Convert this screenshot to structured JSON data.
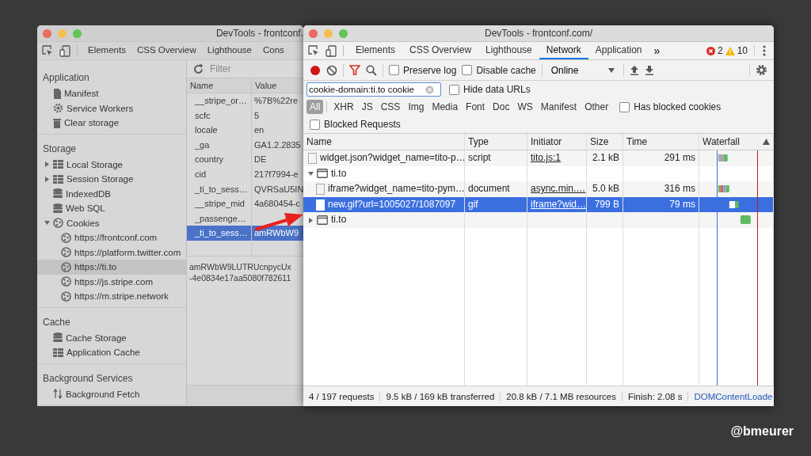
{
  "back_window": {
    "title": "DevTools - frontconf.",
    "tabs": [
      {
        "label": "Elements",
        "selected": false
      },
      {
        "label": "CSS Overview",
        "selected": false
      },
      {
        "label": "Lighthouse",
        "selected": false
      },
      {
        "label": "Cons",
        "selected": false
      }
    ],
    "sidebar": [
      {
        "title": "Application",
        "items": [
          {
            "label": "Manifest",
            "kind": "file",
            "selected": false
          },
          {
            "label": "Service Workers",
            "kind": "gear",
            "selected": false
          },
          {
            "label": "Clear storage",
            "kind": "trash",
            "selected": false
          }
        ]
      },
      {
        "title": "Storage",
        "items": [
          {
            "label": "Local Storage",
            "kind": "grid",
            "expanded": false,
            "selected": false
          },
          {
            "label": "Session Storage",
            "kind": "grid",
            "expanded": false,
            "selected": false
          },
          {
            "label": "IndexedDB",
            "kind": "db",
            "selected": false
          },
          {
            "label": "Web SQL",
            "kind": "db",
            "selected": false
          },
          {
            "label": "Cookies",
            "kind": "cookie",
            "expanded": true,
            "selected": false,
            "children": [
              {
                "label": "https://frontconf.com",
                "kind": "cookie",
                "selected": false
              },
              {
                "label": "https://platform.twitter.com",
                "kind": "cookie",
                "selected": false
              },
              {
                "label": "https://ti.to",
                "kind": "cookie",
                "selected": true
              },
              {
                "label": "https://js.stripe.com",
                "kind": "cookie",
                "selected": false
              },
              {
                "label": "https://m.stripe.network",
                "kind": "cookie",
                "selected": false
              }
            ]
          }
        ]
      },
      {
        "title": "Cache",
        "items": [
          {
            "label": "Cache Storage",
            "kind": "db",
            "selected": false
          },
          {
            "label": "Application Cache",
            "kind": "grid",
            "selected": false
          }
        ]
      },
      {
        "title": "Background Services",
        "items": [
          {
            "label": "Background Fetch",
            "kind": "updown",
            "selected": false
          }
        ]
      }
    ],
    "filter": {
      "placeholder": "Filter"
    },
    "cookies_table": {
      "columns": [
        "Name",
        "Value"
      ],
      "rows": [
        {
          "name": "__stripe_or…",
          "value": "%7B%22re",
          "selected": false
        },
        {
          "name": "scfc",
          "value": "5",
          "selected": false
        },
        {
          "name": "locale",
          "value": "en",
          "selected": false
        },
        {
          "name": "_ga",
          "value": "GA1.2.2835",
          "selected": false
        },
        {
          "name": "country",
          "value": "DE",
          "selected": false
        },
        {
          "name": "cid",
          "value": "217f7994-e",
          "selected": false
        },
        {
          "name": "_ti_to_sess…",
          "value": "QVRSaU5IN",
          "selected": false
        },
        {
          "name": "__stripe_mid",
          "value": "4a680454-c",
          "selected": false
        },
        {
          "name": "_passenge…",
          "selected": false
        },
        {
          "name": "_ti_to_sess…",
          "value": "amRWbW9",
          "selected": true
        }
      ]
    },
    "value_preview": [
      "amRWbW9LUTRUcnpycUx",
      "-4e0834e17aa5080f782611"
    ]
  },
  "front_window": {
    "title": "DevTools - frontconf.com/",
    "tabs": [
      {
        "label": "Elements",
        "selected": false
      },
      {
        "label": "CSS Overview",
        "selected": false
      },
      {
        "label": "Lighthouse",
        "selected": false
      },
      {
        "label": "Network",
        "selected": true
      },
      {
        "label": "Application",
        "selected": false
      }
    ],
    "more_tabs": "»",
    "errors": "2",
    "warnings": "10",
    "toolbar": {
      "recording": true,
      "preserve_log": {
        "label": "Preserve log",
        "checked": false
      },
      "disable_cache": {
        "label": "Disable cache",
        "checked": false
      },
      "throttling": "Online"
    },
    "filter_input": {
      "value": "cookie-domain:ti.to cookie"
    },
    "hide_data_urls": {
      "label": "Hide data URLs",
      "checked": false
    },
    "type_filters": [
      {
        "label": "All",
        "selected": true
      },
      {
        "label": "XHR",
        "selected": false
      },
      {
        "label": "JS",
        "selected": false
      },
      {
        "label": "CSS",
        "selected": false
      },
      {
        "label": "Img",
        "selected": false
      },
      {
        "label": "Media",
        "selected": false
      },
      {
        "label": "Font",
        "selected": false
      },
      {
        "label": "Doc",
        "selected": false
      },
      {
        "label": "WS",
        "selected": false
      },
      {
        "label": "Manifest",
        "selected": false
      },
      {
        "label": "Other",
        "selected": false
      }
    ],
    "has_blocked_cookies": {
      "label": "Has blocked cookies",
      "checked": false
    },
    "blocked_requests": {
      "label": "Blocked Requests",
      "checked": false
    },
    "requests_table": {
      "columns": [
        "Name",
        "Type",
        "Initiator",
        "Size",
        "Time",
        "Waterfall"
      ],
      "rows": [
        {
          "kind": "request",
          "name": "widget.json?widget_name=tito-p…",
          "type": "script",
          "initiator": "tito.js:1",
          "size": "2.1 kB",
          "time": "291 ms",
          "selected": false
        },
        {
          "kind": "group",
          "name": "ti.to",
          "expanded": true,
          "selected": false,
          "children": [
            {
              "kind": "request",
              "name": "iframe?widget_name=tito-pym…",
              "type": "document",
              "initiator": "async.min.…",
              "size": "5.0 kB",
              "time": "316 ms",
              "selected": false
            },
            {
              "kind": "request",
              "name": "new.gif?url=1005027/1087097",
              "type": "gif",
              "initiator": "iframe?wid…",
              "size": "799 B",
              "time": "79 ms",
              "selected": true
            }
          ]
        },
        {
          "kind": "group",
          "name": "ti.to",
          "expanded": false,
          "selected": false
        }
      ]
    },
    "status_bar": {
      "items": [
        "4 / 197 requests",
        "9.5 kB / 169 kB transferred",
        "20.8 kB / 7.1 MB resources",
        "Finish: 2.08 s"
      ],
      "dom_content_loaded": "DOMContentLoade"
    }
  },
  "handle": "@bmeurer"
}
